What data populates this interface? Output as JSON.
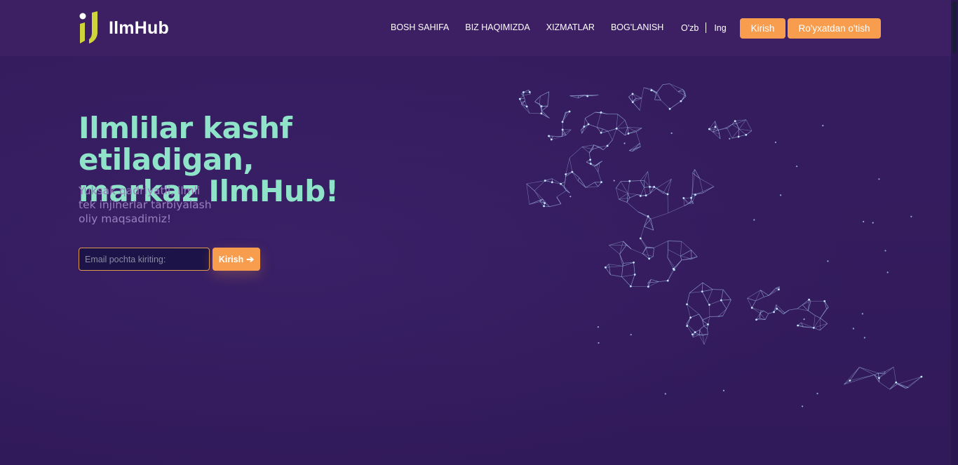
{
  "brand": {
    "name": "IlmHub",
    "colors": {
      "accent_orange": "#f79d4d",
      "title_mint": "#8fe3c8",
      "logo_yellow": "#cfd43a",
      "background": "#331b5c"
    }
  },
  "nav": {
    "items": [
      {
        "label": "BOSH SAHIFA"
      },
      {
        "label": "BIZ HAQIMIZDA"
      },
      {
        "label": "XIZMATLAR"
      },
      {
        "label": "BOG'LANISH"
      }
    ]
  },
  "lang": {
    "current": "O'zb",
    "alternate": "Ing"
  },
  "header_buttons": {
    "login": "Kirish",
    "register": "Ro'yxatdan o'tish"
  },
  "hero": {
    "title_line1": "Ilmlilar kashf etiladigan,",
    "title_line2": "markaz IlmHub!",
    "subtitle": "Yuksak qadriyatli, ilmli tek injinerlar tarbiyalash oliy maqsadimiz!",
    "email_placeholder": "Email pochta kiriting:",
    "email_value": "",
    "submit_label": "Kirish",
    "submit_icon": "arrow-right-icon",
    "illustration": "wireframe-runner-illustration"
  }
}
